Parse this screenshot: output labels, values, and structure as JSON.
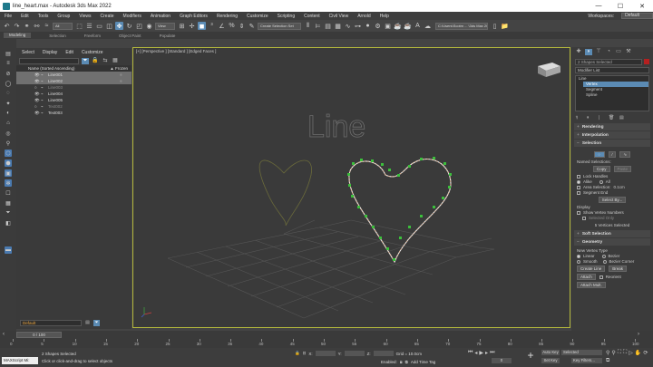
{
  "window": {
    "title": "line_heart.max - Autodesk 3ds Max 2022",
    "min": "—",
    "max": "☐",
    "close": "✕"
  },
  "menu": {
    "items": [
      "File",
      "Edit",
      "Tools",
      "Group",
      "Views",
      "Create",
      "Modifiers",
      "Animation",
      "Graph Editors",
      "Rendering",
      "Customize",
      "Scripting",
      "Content",
      "Civil View",
      "Arnold",
      "Help"
    ],
    "workspaces_label": "Workspaces:",
    "workspace": "Default"
  },
  "toolbar": {
    "filter": "All",
    "view": "View",
    "selection_set": "Create Selection Set",
    "path": "C:\\Users\\Scotm ... \\3ds Max 2022"
  },
  "ribbon": {
    "tabs": [
      "Modeling",
      "Selection",
      "Freeform",
      "Object Paint",
      "Populate"
    ]
  },
  "explorer": {
    "tabs": [
      "Select",
      "Display",
      "Edit",
      "Customize"
    ],
    "header_name": "Name (Sorted Ascending)",
    "header_frozen": "▲ Frozen",
    "rows": [
      {
        "name": "Line001",
        "selected": true,
        "dim": false
      },
      {
        "name": "Line002",
        "selected": true,
        "dim": false
      },
      {
        "name": "Line003",
        "selected": false,
        "dim": true
      },
      {
        "name": "Line004",
        "selected": false,
        "dim": false
      },
      {
        "name": "Line005",
        "selected": false,
        "dim": false
      },
      {
        "name": "Text002",
        "selected": false,
        "dim": true
      },
      {
        "name": "Text003",
        "selected": false,
        "dim": false
      }
    ],
    "layer": "Default"
  },
  "viewport": {
    "label": "[+] [Perspective ] [Standard ] [Edged Faces ]",
    "text": "Line"
  },
  "command_panel": {
    "object_name": "2 Shapes Selected",
    "modifier_list": "Modifier List",
    "stack": [
      "Line",
      "Vertex",
      "Segment",
      "Spline"
    ],
    "rollouts": {
      "rendering": "Rendering",
      "interpolation": "Interpolation",
      "selection": "Selection",
      "soft_selection": "Soft Selection",
      "geometry": "Geometry"
    },
    "selection": {
      "named_selections": "Named Selections:",
      "copy": "Copy",
      "paste": "Paste",
      "lock_handles": "Lock Handles",
      "alike": "Alike",
      "all": "All",
      "area_selection": "Area Selection:",
      "area_value": "0.1cm",
      "segment_end": "Segment End",
      "select_by": "Select By...",
      "display": "Display",
      "show_vertex_numbers": "Show Vertex Numbers",
      "selected_only": "Selected Only",
      "status": "5 Vertices Selected"
    },
    "geometry": {
      "new_vertex_type": "New Vertex Type",
      "linear": "Linear",
      "bezier": "Bezier",
      "smooth": "Smooth",
      "bezier_corner": "Bezier Corner",
      "create_line": "Create Line",
      "break": "Break",
      "attach": "Attach",
      "attach_mult": "Attach Mult.",
      "reorient": "Reorient"
    }
  },
  "timeline": {
    "current": "0 / 100",
    "ticks": [
      "0",
      "5",
      "10",
      "15",
      "20",
      "25",
      "30",
      "35",
      "40",
      "45",
      "50",
      "55",
      "60",
      "65",
      "70",
      "75",
      "80",
      "85",
      "90",
      "95",
      "100"
    ]
  },
  "status": {
    "maxscript": "MAXScript Mi:",
    "line1": "2 Shapes Selected",
    "line2": "Click or click-and-drag to select objects",
    "x_label": "X:",
    "x_val": "",
    "y_label": "Y:",
    "y_val": "",
    "z_label": "Z:",
    "z_val": "",
    "grid": "Grid = 10.0cm",
    "enabled": "Enabled:",
    "add_time_tag": "Add Time Tag",
    "autokey": "Auto Key",
    "selected": "Selected",
    "set_key": "Set Key",
    "key_filters": "Key Filters...",
    "frame": "0"
  }
}
